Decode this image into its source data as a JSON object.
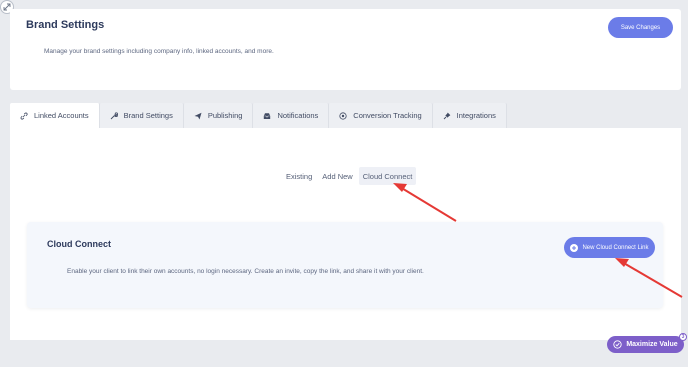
{
  "header": {
    "title": "Brand Settings",
    "description": "Manage your brand settings including company info, linked accounts, and more.",
    "save_label": "Save Changes"
  },
  "tabs": [
    {
      "label": "Linked Accounts",
      "icon": "link-icon",
      "active": true
    },
    {
      "label": "Brand Settings",
      "icon": "wrench-icon",
      "active": false
    },
    {
      "label": "Publishing",
      "icon": "send-icon",
      "active": false
    },
    {
      "label": "Notifications",
      "icon": "inbox-icon",
      "active": false
    },
    {
      "label": "Conversion Tracking",
      "icon": "target-icon",
      "active": false
    },
    {
      "label": "Integrations",
      "icon": "plug-icon",
      "active": false
    }
  ],
  "subtabs": [
    {
      "label": "Existing",
      "active": false
    },
    {
      "label": "Add New",
      "active": false
    },
    {
      "label": "Cloud Connect",
      "active": true
    }
  ],
  "cloud_connect": {
    "title": "Cloud Connect",
    "description": "Enable your client to link their own accounts, no login necessary. Create an invite, copy the link, and share it with your client.",
    "button_label": "New Cloud Connect Link"
  },
  "maximize": {
    "label": "Maximize Value",
    "badge": "3"
  },
  "colors": {
    "accent": "#6b7ce8",
    "annotation_arrow": "#e53935",
    "maximize": "#7d5fc9",
    "background": "#e9ebef"
  }
}
